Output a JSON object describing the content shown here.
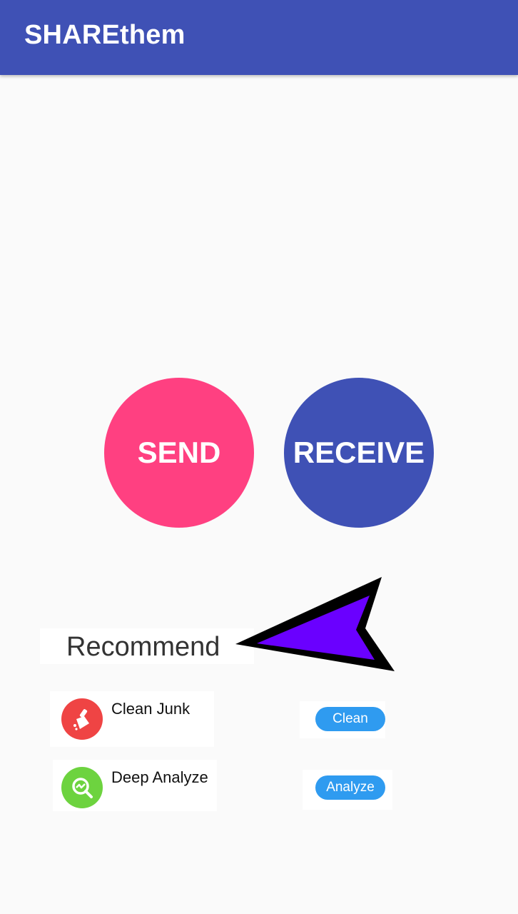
{
  "app_bar": {
    "title": "SHAREthem",
    "color": "#3f51b5"
  },
  "actions": {
    "send_label": "SEND",
    "send_color": "#ff4081",
    "receive_label": "RECEIVE",
    "receive_color": "#3f51b5"
  },
  "recommend": {
    "heading": "Recommend",
    "items": [
      {
        "title": "Clean Junk",
        "button_label": "Clean",
        "icon": "broom-icon",
        "icon_color": "#ef4444"
      },
      {
        "title": "Deep Analyze",
        "button_label": "Analyze",
        "icon": "magnify-analyze-icon",
        "icon_color": "#6dd33f"
      }
    ]
  },
  "annotation": {
    "arrow_color": "#6a00ff"
  }
}
